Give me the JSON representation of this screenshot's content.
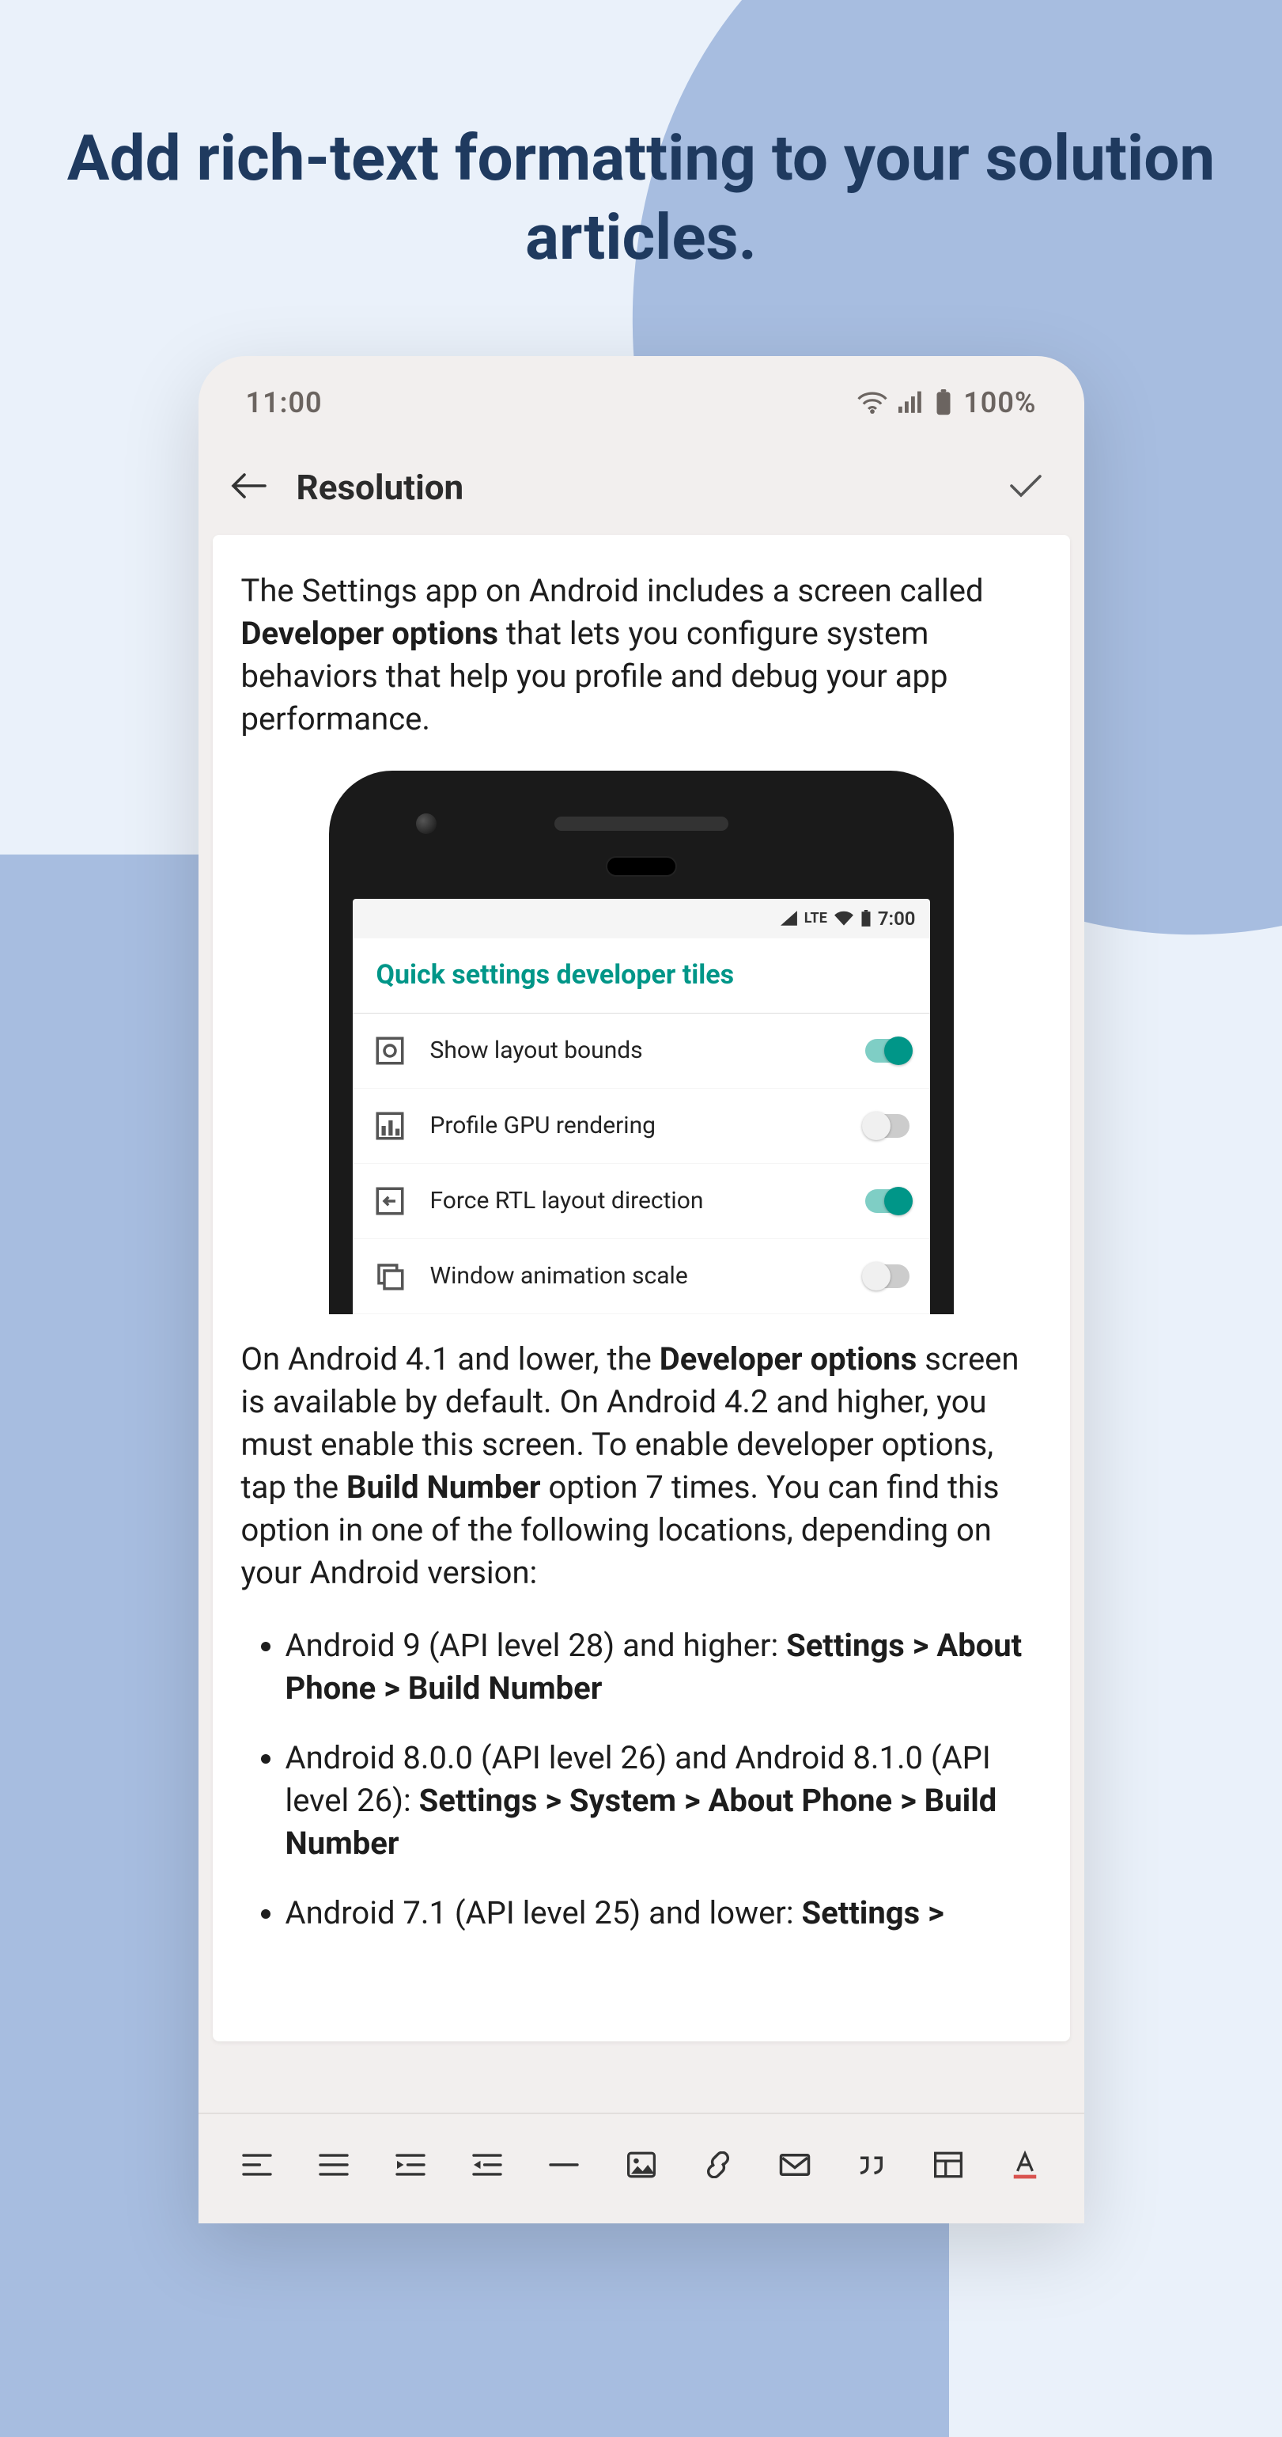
{
  "pageHeading": "Add rich-text formatting to your solution articles.",
  "statusBar": {
    "time": "11:00",
    "battery": "100%"
  },
  "header": {
    "title": "Resolution"
  },
  "article": {
    "p1_a": "The Settings app on Android includes a screen called ",
    "p1_bold": "Developer options",
    "p1_b": " that lets you configure system behaviors that help you profile and debug your app performance.",
    "p2_a": "On Android 4.1 and lower, the ",
    "p2_bold1": "Developer options",
    "p2_b": " screen is available by default. On Android 4.2 and higher, you must enable this screen. To enable developer options, tap the ",
    "p2_bold2": "Build Number",
    "p2_c": " option 7 times. You can find this option in one of the following locations, depending on your Android version:",
    "bullets": [
      {
        "text": "Android 9 (API level 28) and higher: ",
        "bold": "Settings > About Phone > Build Number"
      },
      {
        "text": "Android 8.0.0 (API level 26) and Android 8.1.0 (API level 26): ",
        "bold": "Settings > System > About Phone > Build Number"
      },
      {
        "text": "Android 7.1 (API level 25) and lower: ",
        "bold": "Settings >"
      }
    ]
  },
  "innerPhone": {
    "status": {
      "lte": "LTE",
      "time": "7:00"
    },
    "title": "Quick settings developer tiles",
    "tiles": [
      {
        "label": "Show layout bounds",
        "on": true,
        "icon": "bounds"
      },
      {
        "label": "Profile GPU rendering",
        "on": false,
        "icon": "bars"
      },
      {
        "label": "Force RTL layout direction",
        "on": true,
        "icon": "rtl"
      },
      {
        "label": "Window animation scale",
        "on": false,
        "icon": "windows"
      }
    ]
  },
  "toolbar": {
    "items": [
      "align-left",
      "align-justify",
      "indent",
      "outdent",
      "hr",
      "image",
      "link",
      "email",
      "quote",
      "table",
      "text-color"
    ]
  }
}
